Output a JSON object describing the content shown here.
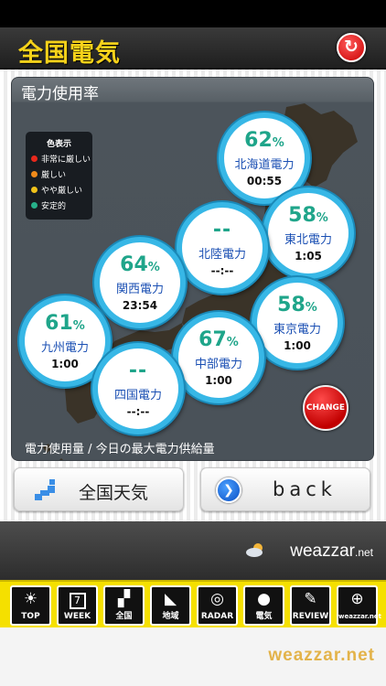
{
  "header": {
    "title": "全国電気",
    "refresh_icon": "refresh-icon"
  },
  "panel": {
    "title": "電力使用率",
    "footer": "電力使用量 / 今日の最大電力供給量",
    "change_label": "CHANGE"
  },
  "legend": {
    "title": "色表示",
    "items": [
      {
        "label": "非常に厳しい",
        "color": "#e8281c"
      },
      {
        "label": "厳しい",
        "color": "#f08a1a"
      },
      {
        "label": "やや厳しい",
        "color": "#f0c21a"
      },
      {
        "label": "安定的",
        "color": "#27b08a"
      }
    ]
  },
  "regions": [
    {
      "name": "北海道電力",
      "percent": "62",
      "unit": "%",
      "time": "00:55"
    },
    {
      "name": "東北電力",
      "percent": "58",
      "unit": "%",
      "time": "1:05"
    },
    {
      "name": "北陸電力",
      "percent": "--",
      "unit": "",
      "time": "--:--"
    },
    {
      "name": "関西電力",
      "percent": "64",
      "unit": "%",
      "time": "23:54"
    },
    {
      "name": "東京電力",
      "percent": "58",
      "unit": "%",
      "time": "1:00"
    },
    {
      "name": "九州電力",
      "percent": "61",
      "unit": "%",
      "time": "1:00"
    },
    {
      "name": "中部電力",
      "percent": "67",
      "unit": "%",
      "time": "1:00"
    },
    {
      "name": "四国電力",
      "percent": "--",
      "unit": "",
      "time": "--:--"
    }
  ],
  "buttons": {
    "weather": "全国天気",
    "back": "back"
  },
  "brand": {
    "name": "weazzar",
    "suffix": ".net"
  },
  "tabs": [
    {
      "label": "TOP",
      "icon": "sun-icon"
    },
    {
      "label": "WEEK",
      "icon": "calendar-icon"
    },
    {
      "label": "全国",
      "icon": "japan-map-icon"
    },
    {
      "label": "地域",
      "icon": "region-map-icon"
    },
    {
      "label": "RADAR",
      "icon": "radar-icon"
    },
    {
      "label": "電気",
      "icon": "lightbulb-icon"
    },
    {
      "label": "REVIEW",
      "icon": "pencil-icon"
    },
    {
      "label": "weazzar.net",
      "icon": "globe-icon"
    }
  ],
  "tab_week_number": "7",
  "footer_brand": "weazzar.net"
}
